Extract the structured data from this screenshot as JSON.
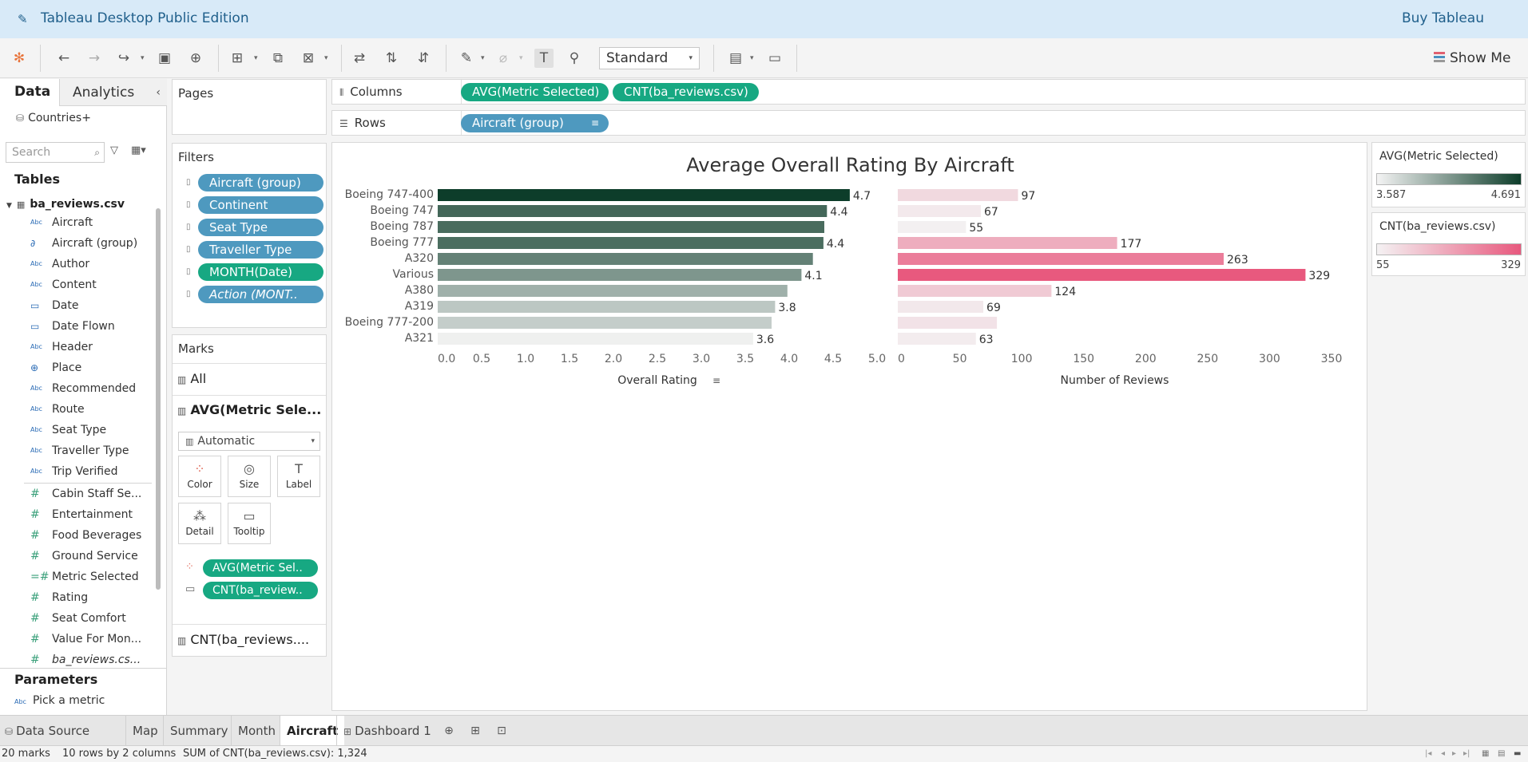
{
  "app": {
    "title": "Tableau Desktop Public Edition",
    "buy_label": "Buy Tableau"
  },
  "toolbar": {
    "presentation_select": "Standard",
    "show_me_label": "Show Me"
  },
  "data_pane": {
    "tab_data": "Data",
    "tab_analytics": "Analytics",
    "datasource": "Countries+",
    "search_placeholder": "Search",
    "tables_header": "Tables",
    "table_name": "ba_reviews.csv",
    "dimension_fields": [
      {
        "type": "Abc",
        "label": "Aircraft"
      },
      {
        "type": "link",
        "label": "Aircraft (group)"
      },
      {
        "type": "Abc",
        "label": "Author"
      },
      {
        "type": "Abc",
        "label": "Content"
      },
      {
        "type": "date",
        "label": "Date"
      },
      {
        "type": "date",
        "label": "Date Flown"
      },
      {
        "type": "Abc",
        "label": "Header"
      },
      {
        "type": "geo",
        "label": "Place"
      },
      {
        "type": "Abc",
        "label": "Recommended"
      },
      {
        "type": "Abc",
        "label": "Route"
      },
      {
        "type": "Abc",
        "label": "Seat Type"
      },
      {
        "type": "Abc",
        "label": "Traveller Type"
      },
      {
        "type": "Abc",
        "label": "Trip Verified"
      }
    ],
    "measure_fields": [
      {
        "type": "#",
        "label": "Cabin Staff Se..."
      },
      {
        "type": "#",
        "label": "Entertainment"
      },
      {
        "type": "#",
        "label": "Food Beverages"
      },
      {
        "type": "#",
        "label": "Ground Service"
      },
      {
        "type": "=#",
        "label": "Metric Selected"
      },
      {
        "type": "#",
        "label": "Rating"
      },
      {
        "type": "#",
        "label": "Seat Comfort"
      },
      {
        "type": "#",
        "label": "Value For Mon..."
      },
      {
        "type": "#",
        "label": "ba_reviews.cs..."
      }
    ],
    "parameters_header": "Parameters",
    "parameter": "Pick a metric"
  },
  "cards": {
    "pages_title": "Pages",
    "filters_title": "Filters",
    "filters": [
      {
        "label": "Aircraft (group)",
        "color": "#4e99bf"
      },
      {
        "label": "Continent",
        "color": "#4e99bf"
      },
      {
        "label": "Seat Type",
        "color": "#4e99bf"
      },
      {
        "label": "Traveller Type",
        "color": "#4e99bf"
      },
      {
        "label": "MONTH(Date)",
        "color": "#17a882"
      },
      {
        "label": "Action (MONT..",
        "color": "#4e99bf"
      }
    ],
    "marks_title": "Marks",
    "marks_all": "All",
    "marks_sheet1": "AVG(Metric Sele...",
    "mark_type": "Automatic",
    "mark_buttons": [
      "Color",
      "Size",
      "Label",
      "Detail",
      "Tooltip"
    ],
    "mark_pills": [
      "AVG(Metric Sel..",
      "CNT(ba_review.."
    ],
    "marks_sheet2": "CNT(ba_reviews...."
  },
  "shelves": {
    "columns_label": "Columns",
    "rows_label": "Rows",
    "column_pills": [
      "AVG(Metric Selected)",
      "CNT(ba_reviews.csv)"
    ],
    "row_pill": "Aircraft (group)"
  },
  "chart_data": {
    "type": "bar",
    "title": "Average Overall Rating By Aircraft",
    "categories": [
      "Boeing 747-400",
      "Boeing 747",
      "Boeing 787",
      "Boeing 777",
      "A320",
      "Various",
      "A380",
      "A319",
      "Boeing 777-200",
      "A321"
    ],
    "series": [
      {
        "name": "AVG(Metric Selected)",
        "values": [
          4.69,
          4.43,
          4.4,
          4.39,
          4.27,
          4.14,
          3.98,
          3.84,
          3.8,
          3.59
        ],
        "labels": [
          "4.7",
          "4.4",
          "",
          "4.4",
          "",
          "4.1",
          "",
          "3.8",
          "",
          "3.6"
        ],
        "xlabel": "Overall Rating",
        "xlim": [
          0,
          5
        ],
        "ticks": [
          "0.0",
          "0.5",
          "1.0",
          "1.5",
          "2.0",
          "2.5",
          "3.0",
          "3.5",
          "4.0",
          "4.5",
          "5.0"
        ],
        "color_range": [
          3.587,
          4.691
        ],
        "colors": [
          "#f0f0f0",
          "#0d3d2a"
        ]
      },
      {
        "name": "CNT(ba_reviews.csv)",
        "values": [
          97,
          67,
          55,
          177,
          263,
          329,
          124,
          69,
          80,
          63
        ],
        "labels": [
          "97",
          "67",
          "55",
          "177",
          "263",
          "329",
          "124",
          "69",
          "",
          "63"
        ],
        "xlabel": "Number of Reviews",
        "xlim": [
          0,
          350
        ],
        "ticks": [
          "0",
          "50",
          "100",
          "150",
          "200",
          "250",
          "300",
          "350"
        ],
        "color_range": [
          55,
          329
        ],
        "colors": [
          "#f3f0f1",
          "#e8597e"
        ]
      }
    ]
  },
  "legends": [
    {
      "title": "AVG(Metric Selected)",
      "min": "3.587",
      "max": "4.691",
      "colors": [
        "#f4f4f4",
        "#0d3d2a"
      ]
    },
    {
      "title": "CNT(ba_reviews.csv)",
      "min": "55",
      "max": "329",
      "colors": [
        "#f4f2f3",
        "#e8597e"
      ]
    }
  ],
  "sheet_tabs": {
    "datasource_tab": "Data Source",
    "tabs": [
      "Map",
      "Summary",
      "Month",
      "Aircraft",
      "Dashboard 1"
    ],
    "active": "Aircraft"
  },
  "status": {
    "marks": "20 marks",
    "rows_cols": "10 rows by 2 columns",
    "sum": "SUM of CNT(ba_reviews.csv): 1,324"
  }
}
